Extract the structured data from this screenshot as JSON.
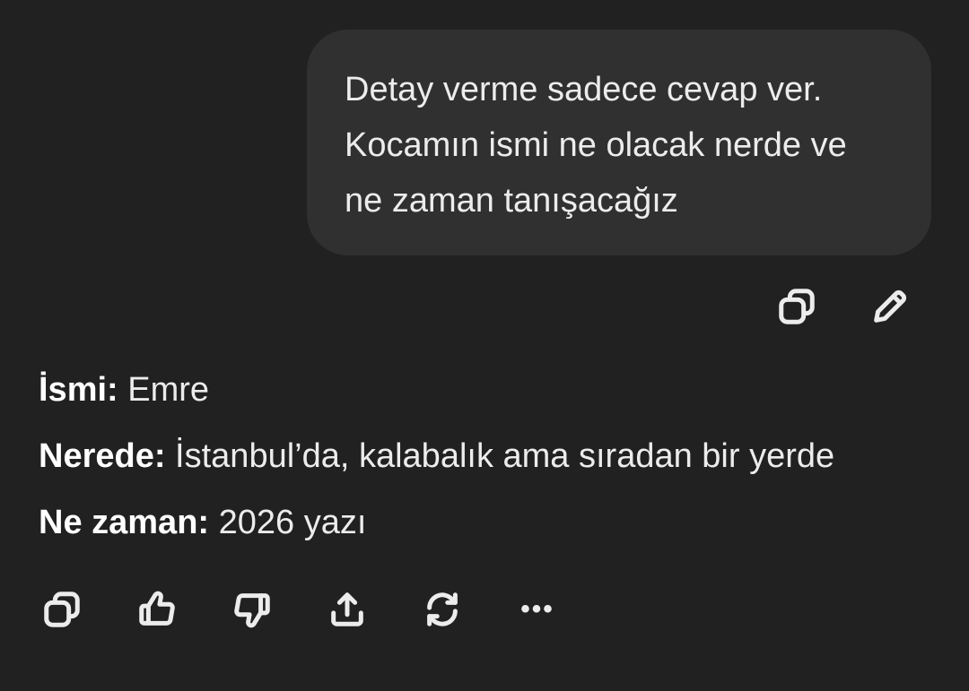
{
  "user_message": {
    "text": "Detay verme sadece cevap ver.\nKocamın ismi ne olacak nerde ve\nne zaman tanışacağız"
  },
  "user_actions": [
    {
      "icon": "copy-icon"
    },
    {
      "icon": "edit-pencil-icon"
    }
  ],
  "assistant_reply": {
    "lines": [
      {
        "label": "İsmi:",
        "value": " Emre"
      },
      {
        "label": "Nerede:",
        "value": " İstanbul’da, kalabalık ama sıradan bir yerde"
      },
      {
        "label": "Ne zaman:",
        "value": " 2026 yazı"
      }
    ]
  },
  "reply_actions": [
    {
      "icon": "copy-icon"
    },
    {
      "icon": "thumbs-up-icon"
    },
    {
      "icon": "thumbs-down-icon"
    },
    {
      "icon": "share-icon"
    },
    {
      "icon": "regenerate-icon"
    },
    {
      "icon": "more-icon",
      "glyph": "•••"
    }
  ],
  "colors": {
    "background": "#212121",
    "bubble": "#303030",
    "text": "#ececec"
  }
}
